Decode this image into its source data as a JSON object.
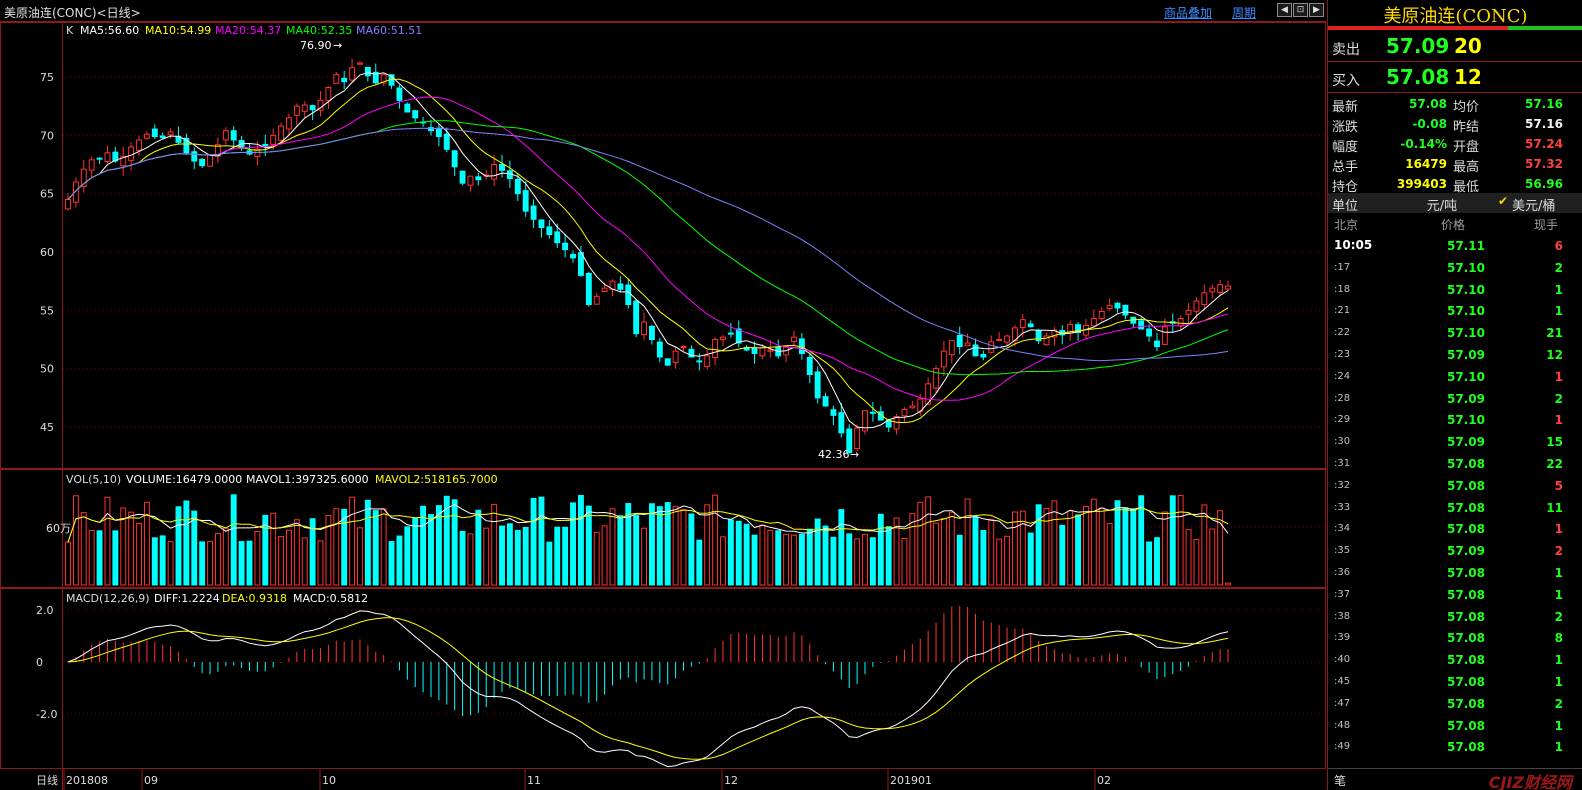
{
  "title": "美原油连(CONC)<日线>",
  "toolbar": {
    "overlay_label": "商品叠加",
    "period_label": "周期",
    "btn_prev": "◀",
    "btn_mid": "⊡",
    "btn_next": "▶"
  },
  "legends": {
    "main": {
      "k": "K",
      "ma5": "MA5:56.60",
      "ma10": "MA10:54.99",
      "ma20": "MA20:54.37",
      "ma40": "MA40:52.35",
      "ma60": "MA60:51.51"
    },
    "vol": {
      "name": "VOL(5,10)",
      "volume": "VOLUME:16479.0000",
      "mavol1": "MAVOL1:397325.6000",
      "mavol2": "MAVOL2:518165.7000"
    },
    "macd": {
      "name": "MACD(12,26,9)",
      "diff": "DIFF:1.2224",
      "dea": "DEA:0.9318",
      "macd": "MACD:0.5812"
    }
  },
  "annotations": {
    "high": "76.90",
    "low": "42.36"
  },
  "axis": {
    "price_ticks": [
      "75",
      "70",
      "65",
      "60",
      "55",
      "50",
      "45"
    ],
    "vol_tick": "60万",
    "macd_ticks": [
      "2.0",
      "0",
      "-2.0"
    ],
    "period": "日线",
    "dates": [
      "201808",
      "09",
      "10",
      "11",
      "12",
      "201901",
      "02"
    ]
  },
  "colors": {
    "up": "#ff3030",
    "down": "#00ffff",
    "ma5": "#ffffff",
    "ma10": "#ffff00",
    "ma20": "#ff00ff",
    "ma40": "#00ff00",
    "ma60": "#8080ff",
    "grid": "#800000"
  },
  "chart_data": {
    "type": "candlestick",
    "ylim": [
      42,
      78
    ],
    "closes": [
      64.5,
      66.0,
      67.1,
      67.9,
      68.0,
      68.5,
      67.8,
      68.2,
      69.0,
      69.6,
      70.1,
      69.9,
      69.8,
      70.3,
      69.4,
      68.5,
      67.8,
      67.4,
      68.3,
      69.2,
      70.4,
      69.6,
      68.9,
      68.4,
      68.8,
      69.0,
      70.0,
      70.8,
      71.5,
      72.5,
      72.6,
      72.2,
      73.0,
      74.1,
      75.2,
      74.6,
      75.8,
      76.2,
      75.1,
      74.5,
      75.2,
      74.3,
      73.0,
      72.0,
      71.5,
      71.1,
      70.4,
      69.9,
      68.8,
      67.3,
      65.9,
      66.5,
      66.2,
      66.6,
      67.5,
      67.0,
      66.3,
      65.0,
      63.5,
      62.8,
      62.1,
      61.5,
      60.8,
      60.2,
      59.5,
      58.0,
      55.5,
      56.2,
      56.9,
      57.5,
      56.8,
      55.5,
      53.0,
      54.0,
      52.5,
      51.0,
      50.3,
      51.5,
      51.9,
      51.0,
      50.6,
      51.1,
      52.5,
      52.7,
      53.0,
      52.2,
      51.6,
      51.3,
      51.8,
      51.6,
      51.1,
      51.9,
      52.7,
      51.3,
      49.5,
      47.5,
      46.8,
      46.0,
      44.5,
      42.8,
      44.9,
      46.4,
      46.2,
      45.6,
      45.0,
      45.9,
      46.5,
      46.8,
      47.4,
      48.7,
      50.0,
      51.5,
      52.4,
      51.9,
      52.2,
      51.1,
      51.0,
      52.3,
      52.5,
      52.8,
      53.5,
      54.2,
      53.6,
      52.4,
      52.8,
      53.3,
      52.9,
      53.8,
      53.1,
      53.7,
      54.3,
      54.9,
      55.4,
      55.2,
      54.6,
      53.9,
      53.4,
      52.8,
      51.9,
      53.6,
      53.9,
      54.3,
      55.0,
      55.8,
      56.5,
      56.9,
      57.2,
      57.08
    ],
    "ma_values": {
      "ma5": 56.6,
      "ma10": 54.99,
      "ma20": 54.37,
      "ma40": 52.35,
      "ma60": 51.51
    },
    "high": 76.9,
    "low": 42.36
  },
  "quote": {
    "name": "美原油连(CONC)",
    "sell": {
      "label": "卖出",
      "price": "57.09",
      "qty": "20"
    },
    "buy": {
      "label": "买入",
      "price": "57.08",
      "qty": "12"
    },
    "rows": [
      {
        "l1": "最新",
        "v1": "57.08",
        "c1": "green",
        "l2": "均价",
        "v2": "57.16",
        "c2": "green"
      },
      {
        "l1": "涨跌",
        "v1": "-0.08",
        "c1": "green",
        "l2": "昨结",
        "v2": "57.16",
        "c2": "white"
      },
      {
        "l1": "幅度",
        "v1": "-0.14%",
        "c1": "green",
        "l2": "开盘",
        "v2": "57.24",
        "c2": "red"
      },
      {
        "l1": "总手",
        "v1": "16479",
        "c1": "yellow",
        "l2": "最高",
        "v2": "57.32",
        "c2": "red"
      },
      {
        "l1": "持仓",
        "v1": "399403",
        "c1": "yellow",
        "l2": "最低",
        "v2": "56.96",
        "c2": "green"
      }
    ],
    "unit": {
      "label": "单位",
      "yuan": "元/吨",
      "usd": "美元/桶",
      "check": "✔"
    },
    "tick_header": {
      "time": "北京",
      "price": "价格",
      "vol": "现手"
    },
    "ticks": [
      {
        "t": "10:05",
        "p": "57.11",
        "v": "6",
        "c": "red"
      },
      {
        "t": ":17",
        "p": "57.10",
        "v": "2",
        "c": "green"
      },
      {
        "t": ":18",
        "p": "57.10",
        "v": "1",
        "c": "green"
      },
      {
        "t": ":21",
        "p": "57.10",
        "v": "1",
        "c": "green"
      },
      {
        "t": ":22",
        "p": "57.10",
        "v": "21",
        "c": "green"
      },
      {
        "t": ":23",
        "p": "57.09",
        "v": "12",
        "c": "green"
      },
      {
        "t": ":24",
        "p": "57.10",
        "v": "1",
        "c": "red"
      },
      {
        "t": ":28",
        "p": "57.09",
        "v": "2",
        "c": "green"
      },
      {
        "t": ":29",
        "p": "57.10",
        "v": "1",
        "c": "red"
      },
      {
        "t": ":30",
        "p": "57.09",
        "v": "15",
        "c": "green"
      },
      {
        "t": ":31",
        "p": "57.08",
        "v": "22",
        "c": "green"
      },
      {
        "t": ":32",
        "p": "57.08",
        "v": "5",
        "c": "red"
      },
      {
        "t": ":33",
        "p": "57.08",
        "v": "11",
        "c": "green"
      },
      {
        "t": ":34",
        "p": "57.08",
        "v": "1",
        "c": "red"
      },
      {
        "t": ":35",
        "p": "57.09",
        "v": "2",
        "c": "red"
      },
      {
        "t": ":36",
        "p": "57.08",
        "v": "1",
        "c": "green"
      },
      {
        "t": ":37",
        "p": "57.08",
        "v": "1",
        "c": "green"
      },
      {
        "t": ":38",
        "p": "57.08",
        "v": "2",
        "c": "green"
      },
      {
        "t": ":39",
        "p": "57.08",
        "v": "8",
        "c": "green"
      },
      {
        "t": ":40",
        "p": "57.08",
        "v": "1",
        "c": "green"
      },
      {
        "t": ":45",
        "p": "57.08",
        "v": "1",
        "c": "green"
      },
      {
        "t": ":47",
        "p": "57.08",
        "v": "2",
        "c": "green"
      },
      {
        "t": ":48",
        "p": "57.08",
        "v": "1",
        "c": "green"
      },
      {
        "t": ":49",
        "p": "57.08",
        "v": "1",
        "c": "green"
      }
    ],
    "footer": "笔",
    "watermark": "CJIZ财经网"
  }
}
